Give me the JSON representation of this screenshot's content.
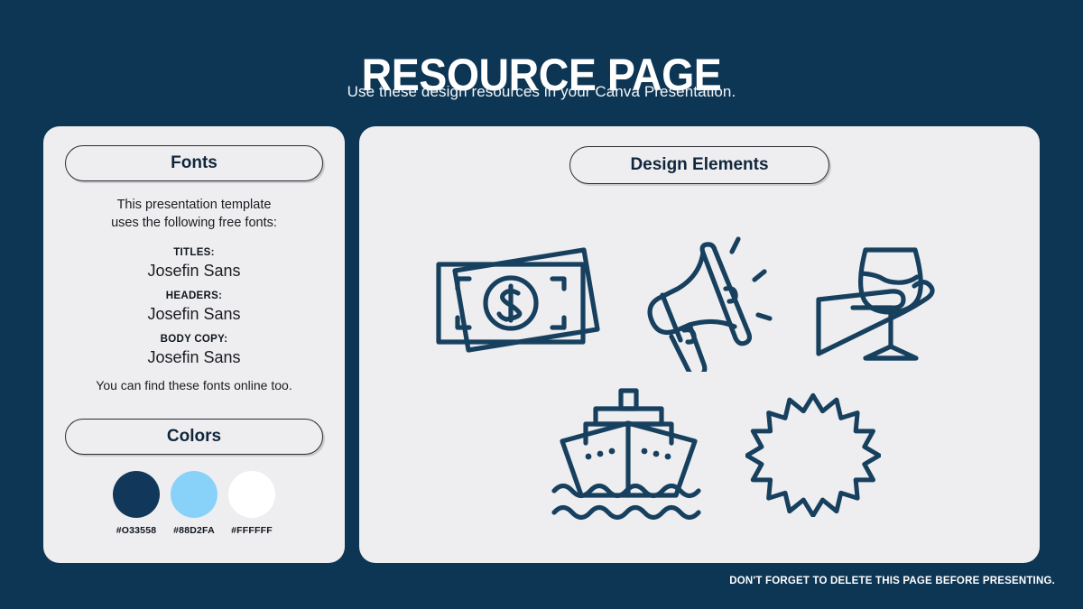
{
  "header": {
    "title": "RESOURCE PAGE",
    "subtitle": "Use these design resources in your Canva Presentation."
  },
  "fonts_panel": {
    "heading": "Fonts",
    "intro_line1": "This presentation template",
    "intro_line2": "uses the following free fonts:",
    "groups": [
      {
        "role": "TITLES:",
        "family": "Josefin Sans"
      },
      {
        "role": "HEADERS:",
        "family": "Josefin Sans"
      },
      {
        "role": "BODY COPY:",
        "family": "Josefin Sans"
      }
    ],
    "note": "You can find these fonts online too."
  },
  "colors_panel": {
    "heading": "Colors",
    "swatches": [
      {
        "code": "#O33558",
        "hex": "#11385a"
      },
      {
        "code": "#88D2FA",
        "hex": "#88d2fa"
      },
      {
        "code": "#FFFFFF",
        "hex": "#ffffff"
      }
    ]
  },
  "design_panel": {
    "heading": "Design Elements",
    "elements": [
      {
        "name": "money-icon",
        "label": "Banknotes with dollar sign"
      },
      {
        "name": "megaphone-icon",
        "label": "Megaphone with sound lines"
      },
      {
        "name": "wine-glass-icon",
        "label": "Hand holding wine glass"
      },
      {
        "name": "cruise-ship-icon",
        "label": "Cruise ship on waves"
      },
      {
        "name": "starburst-badge-icon",
        "label": "Starburst badge outline"
      }
    ]
  },
  "footer": {
    "note": "DON'T FORGET TO DELETE THIS PAGE BEFORE PRESENTING."
  },
  "theme": {
    "background": "#0d3655",
    "panel": "#eeeef0",
    "ink": "#10263c",
    "icon_stroke": "#17405f"
  }
}
